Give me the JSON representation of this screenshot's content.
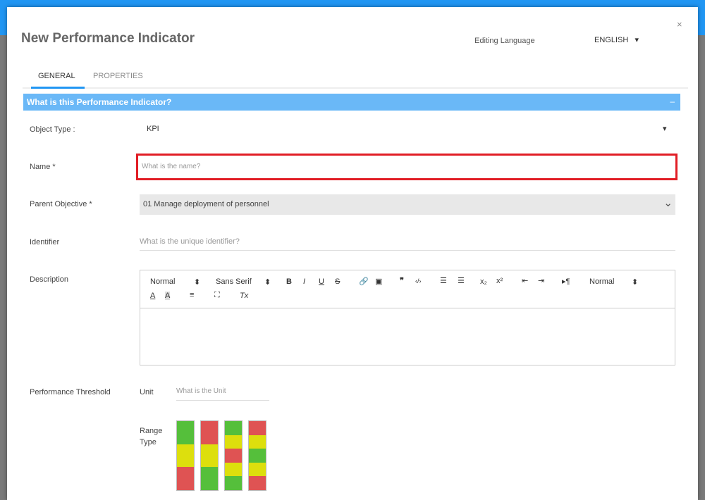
{
  "dialog": {
    "title": "New Performance Indicator",
    "close": "×",
    "editing_language_label": "Editing Language",
    "language": "ENGLISH",
    "language_caret": "▾"
  },
  "tabs": [
    {
      "label": "GENERAL",
      "active": true
    },
    {
      "label": "PROPERTIES",
      "active": false
    }
  ],
  "section": {
    "title": "What is this Performance Indicator?",
    "toggle": "–"
  },
  "form": {
    "object_type": {
      "label": "Object Type :",
      "value": "KPI",
      "caret": "▾"
    },
    "name": {
      "label": "Name *",
      "placeholder": "What is the name?"
    },
    "parent": {
      "label": "Parent Objective *",
      "value": "01 Manage deployment of personnel",
      "caret": "⌄"
    },
    "identifier": {
      "label": "Identifier",
      "placeholder": "What is the unique identifier?"
    },
    "description": {
      "label": "Description",
      "toolbar": {
        "header": "Normal",
        "font": "Sans Serif",
        "size": "Normal",
        "updown": "⬍",
        "bold": "B",
        "italic": "I",
        "underline": "U",
        "strike": "S",
        "quote": "❞",
        "code": "‹/›",
        "sub": "x₂",
        "sup": "x²",
        "rtl": "▸¶",
        "color": "A",
        "bg": "A",
        "align": "≡",
        "fullscreen": "⛶",
        "clean": "Tx"
      }
    },
    "threshold": {
      "label": "Performance Threshold",
      "unit_label": "Unit",
      "unit_placeholder": "What is the Unit",
      "range_label": "Range Type",
      "range_types": [
        [
          "g",
          "y",
          "r"
        ],
        [
          "r",
          "y",
          "g"
        ],
        [
          "g",
          "y",
          "r",
          "y",
          "g"
        ],
        [
          "r",
          "y",
          "g",
          "y",
          "r"
        ]
      ]
    }
  },
  "colors": {
    "accent": "#2196f3",
    "section": "#6ab8f7",
    "error": "#e11d25",
    "green": "#55bf3b",
    "yellow": "#dddf0d",
    "red": "#df5353"
  }
}
